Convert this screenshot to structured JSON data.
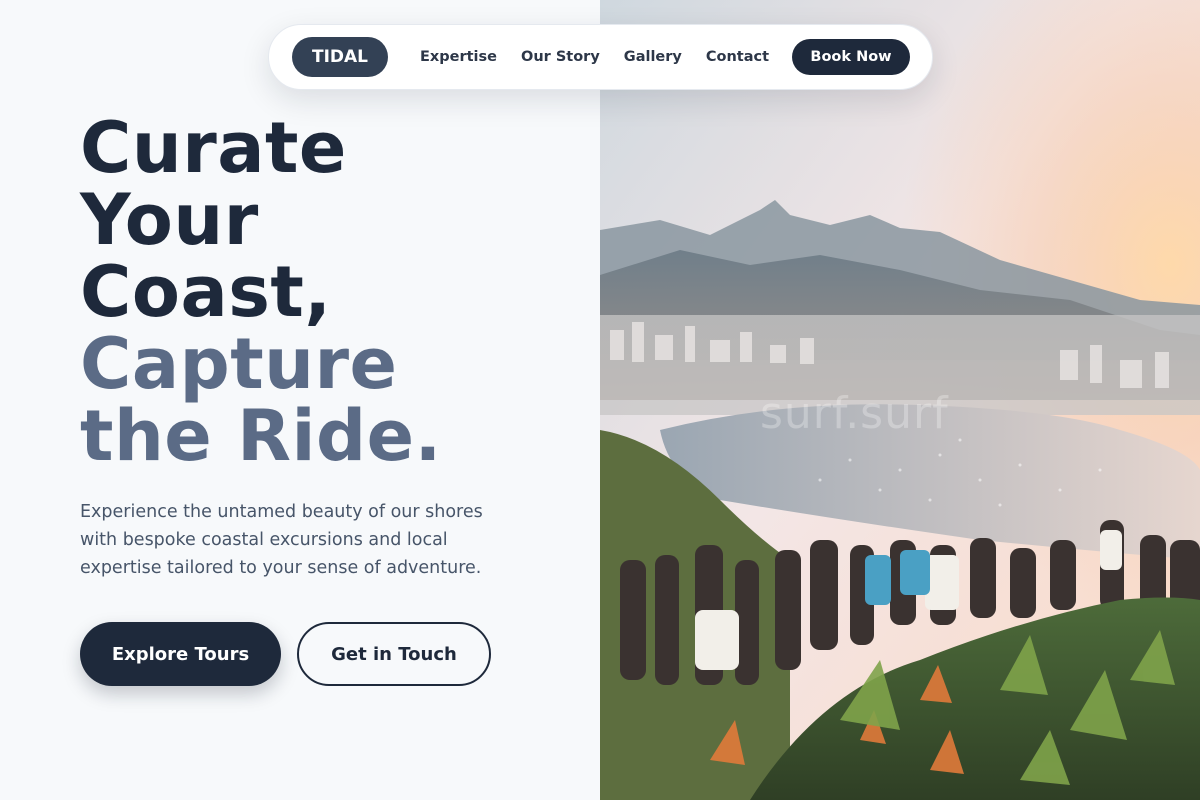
{
  "brand": {
    "logo": "TIDAL"
  },
  "nav": {
    "links": [
      "Expertise",
      "Our Story",
      "Gallery",
      "Contact"
    ],
    "cta": "Book Now"
  },
  "hero": {
    "headline_dark": [
      "Curate",
      "Your",
      "Coast,"
    ],
    "headline_muted": [
      "Capture",
      "the Ride."
    ],
    "intro": "Experience the untamed beauty of our shores with bespoke coastal excursions and local expertise tailored to your sense of adventure.",
    "primary_button": "Explore Tours",
    "secondary_button": "Get in Touch"
  },
  "photo": {
    "watermark": "surf.surf",
    "icon": "coastal-viewpoint-photo"
  },
  "colors": {
    "primary": "#1e293b",
    "muted_heading": "#5b6b86",
    "body_text": "#475569",
    "background": "#f7f9fb",
    "logo_bg": "#334155"
  }
}
